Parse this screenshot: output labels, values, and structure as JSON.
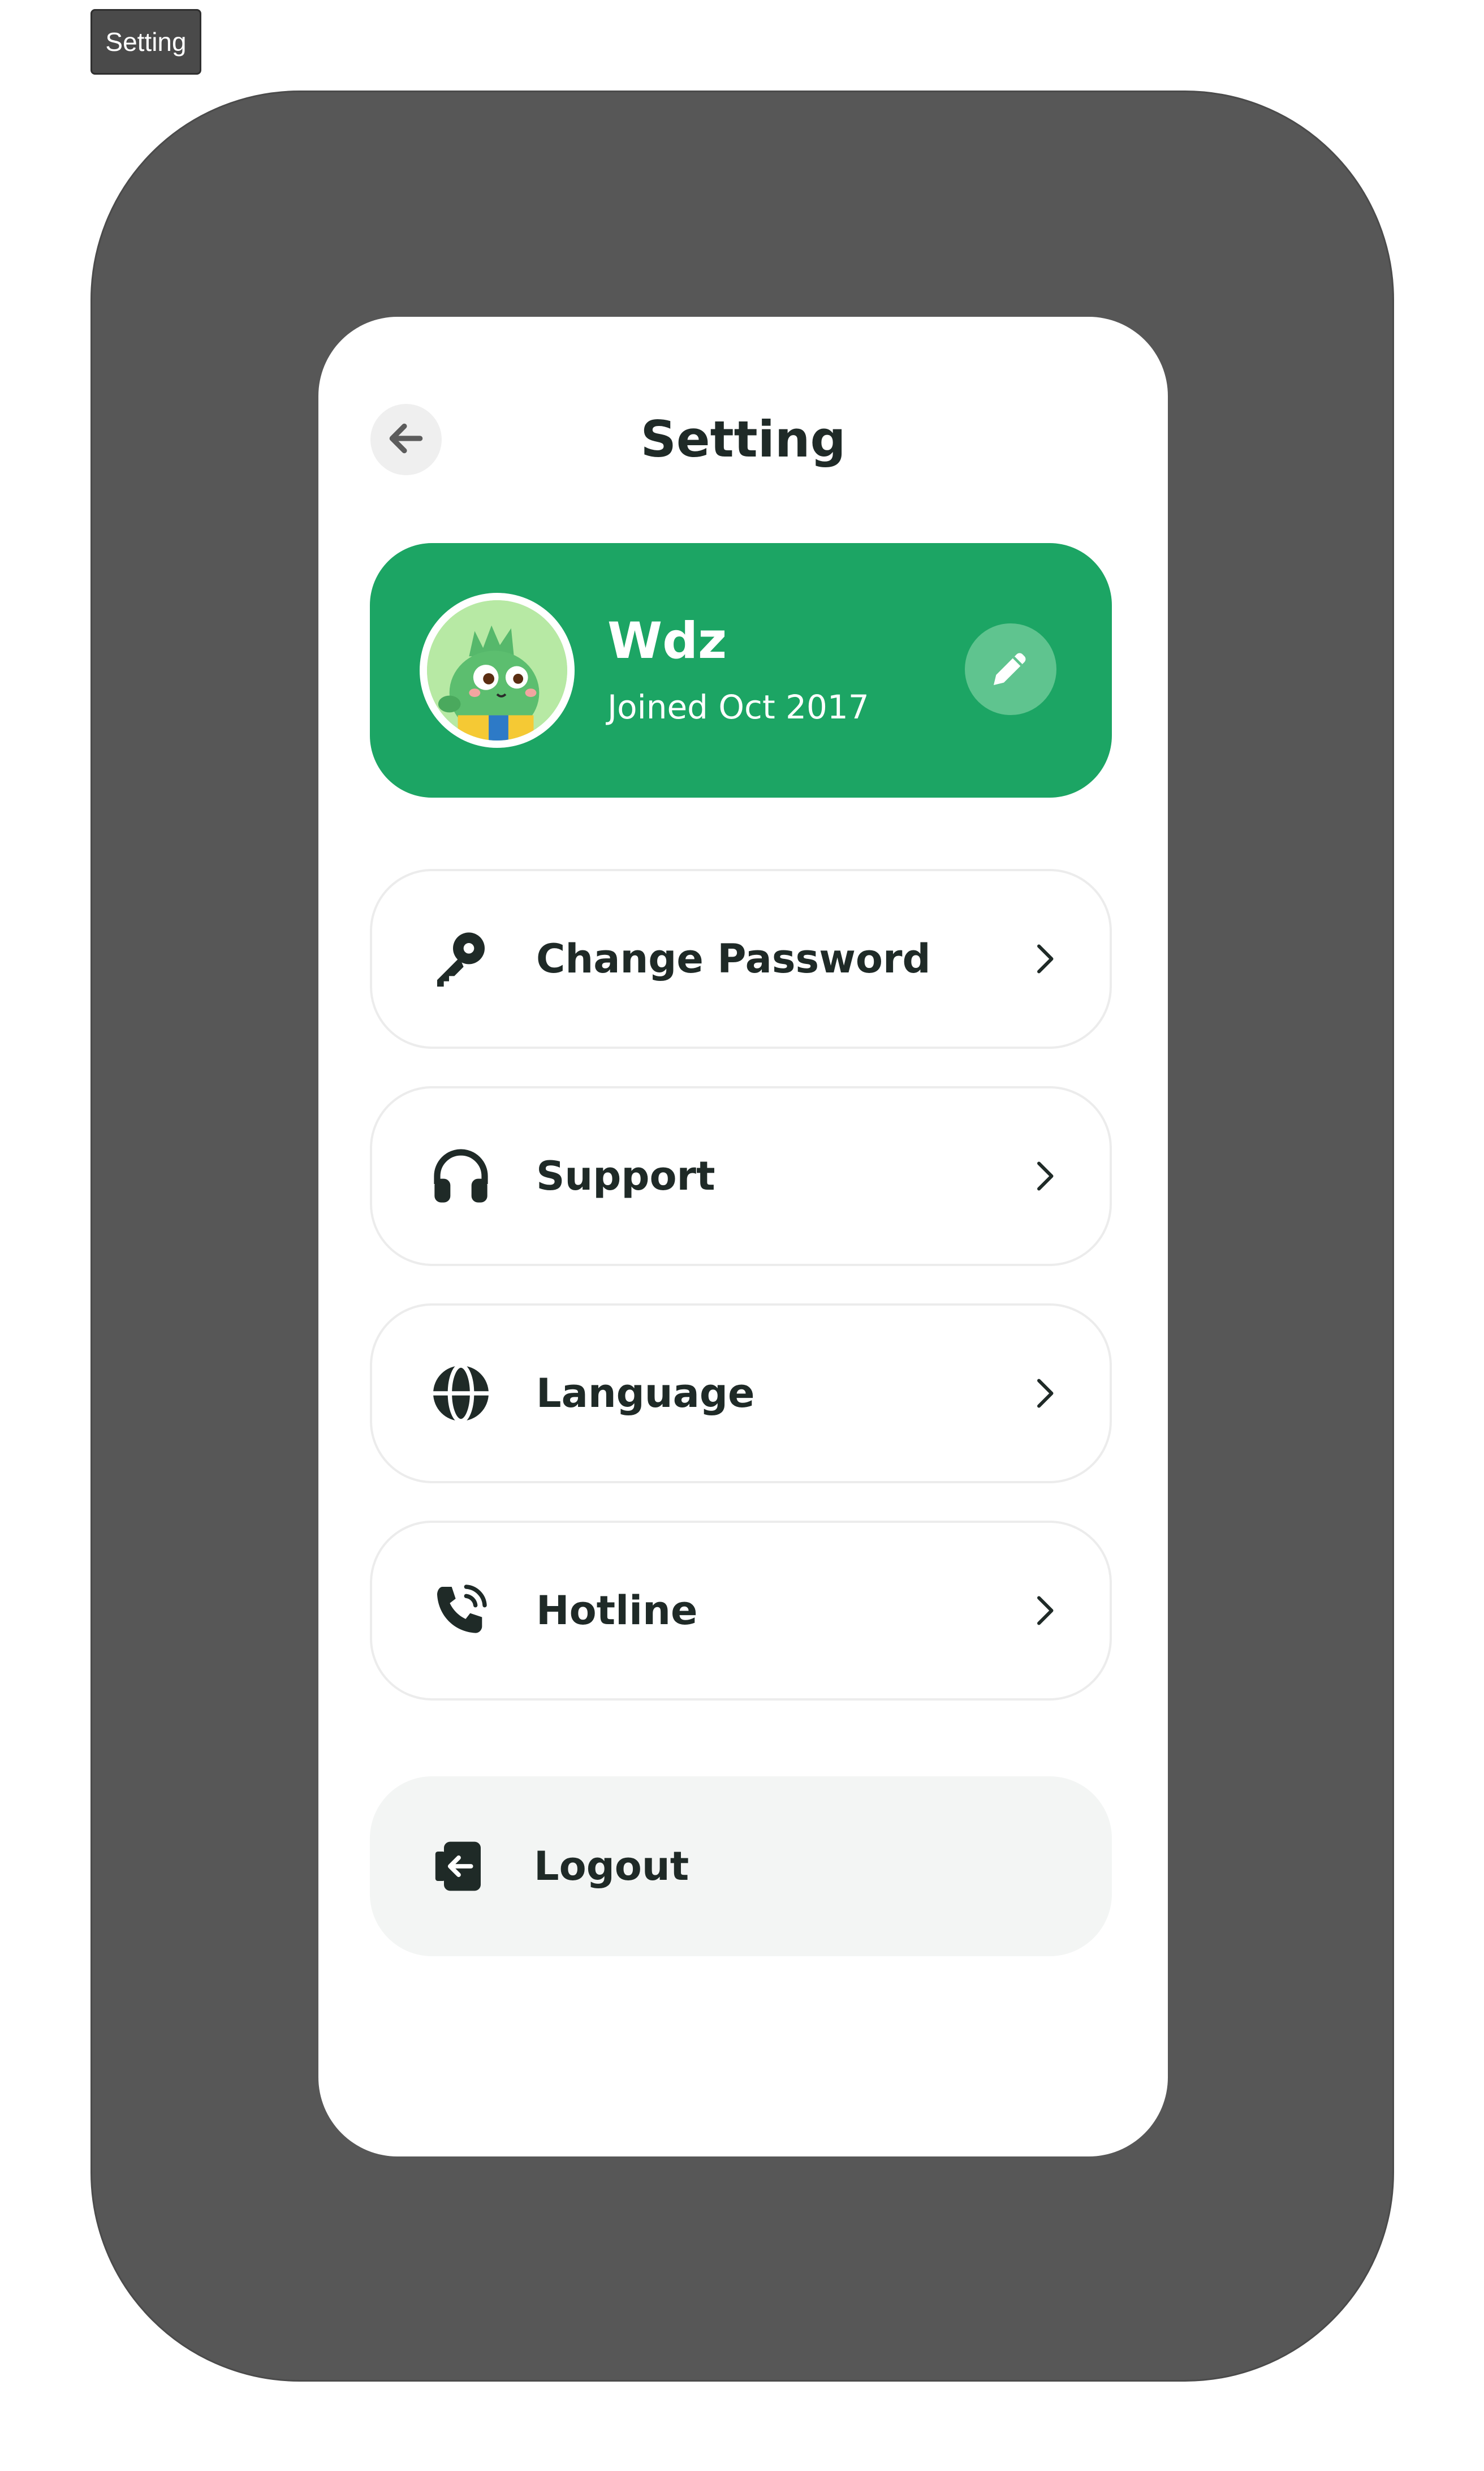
{
  "frame_label": "Setting",
  "header": {
    "title": "Setting",
    "back_icon": "arrow-left-icon"
  },
  "profile": {
    "name": "Wdz",
    "joined": "Joined Oct 2017",
    "avatar_icon": "dino-avatar",
    "edit_icon": "pencil-icon",
    "card_color": "#1ca564"
  },
  "menu": [
    {
      "label": "Change Password",
      "icon": "key-icon"
    },
    {
      "label": "Support",
      "icon": "headphones-icon"
    },
    {
      "label": "Language",
      "icon": "globe-icon"
    },
    {
      "label": "Hotline",
      "icon": "phone-ringing-icon"
    }
  ],
  "logout": {
    "label": "Logout",
    "icon": "logout-icon"
  },
  "colors": {
    "accent": "#1ca564",
    "text": "#1f2a27",
    "device": "#575757"
  }
}
